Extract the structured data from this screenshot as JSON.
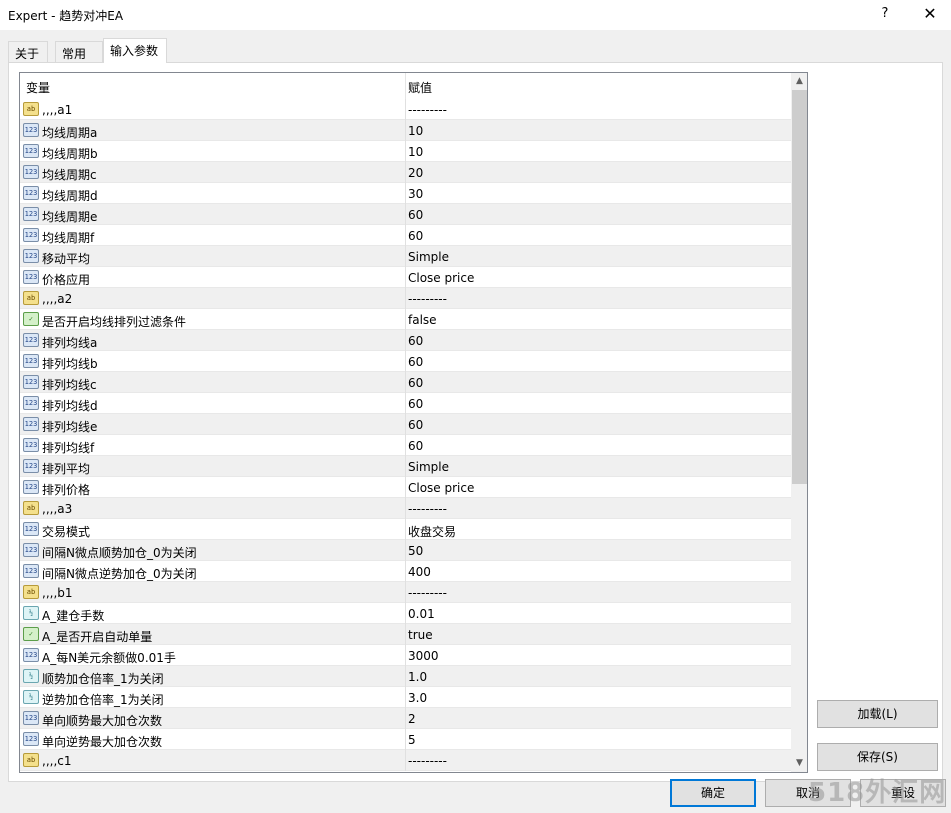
{
  "window": {
    "title": "Expert - 趋势对冲EA",
    "help_glyph": "?",
    "close_glyph": "✕"
  },
  "tabs": [
    {
      "label": "关于",
      "active": false
    },
    {
      "label": "常用",
      "active": false
    },
    {
      "label": "输入参数",
      "active": true
    }
  ],
  "grid": {
    "col_variable": "变量",
    "col_value": "赋值",
    "rows": [
      {
        "type": "str",
        "icon": "string-icon",
        "icon_text": "ab",
        "name": ",,,,a1",
        "value": "---------"
      },
      {
        "type": "int",
        "icon": "integer-icon",
        "icon_text": "123",
        "name": "均线周期a",
        "value": "10"
      },
      {
        "type": "int",
        "icon": "integer-icon",
        "icon_text": "123",
        "name": "均线周期b",
        "value": "10"
      },
      {
        "type": "int",
        "icon": "integer-icon",
        "icon_text": "123",
        "name": "均线周期c",
        "value": "20"
      },
      {
        "type": "int",
        "icon": "integer-icon",
        "icon_text": "123",
        "name": "均线周期d",
        "value": "30"
      },
      {
        "type": "int",
        "icon": "integer-icon",
        "icon_text": "123",
        "name": "均线周期e",
        "value": "60"
      },
      {
        "type": "int",
        "icon": "integer-icon",
        "icon_text": "123",
        "name": "均线周期f",
        "value": "60"
      },
      {
        "type": "int",
        "icon": "integer-icon",
        "icon_text": "123",
        "name": "移动平均",
        "value": "Simple"
      },
      {
        "type": "int",
        "icon": "integer-icon",
        "icon_text": "123",
        "name": "价格应用",
        "value": "Close price"
      },
      {
        "type": "str",
        "icon": "string-icon",
        "icon_text": "ab",
        "name": ",,,,a2",
        "value": "---------"
      },
      {
        "type": "bool",
        "icon": "boolean-icon",
        "icon_text": "✓",
        "name": "是否开启均线排列过滤条件",
        "value": "false"
      },
      {
        "type": "int",
        "icon": "integer-icon",
        "icon_text": "123",
        "name": "排列均线a",
        "value": "60"
      },
      {
        "type": "int",
        "icon": "integer-icon",
        "icon_text": "123",
        "name": "排列均线b",
        "value": "60"
      },
      {
        "type": "int",
        "icon": "integer-icon",
        "icon_text": "123",
        "name": "排列均线c",
        "value": "60"
      },
      {
        "type": "int",
        "icon": "integer-icon",
        "icon_text": "123",
        "name": "排列均线d",
        "value": "60"
      },
      {
        "type": "int",
        "icon": "integer-icon",
        "icon_text": "123",
        "name": "排列均线e",
        "value": "60"
      },
      {
        "type": "int",
        "icon": "integer-icon",
        "icon_text": "123",
        "name": "排列均线f",
        "value": "60"
      },
      {
        "type": "int",
        "icon": "integer-icon",
        "icon_text": "123",
        "name": "排列平均",
        "value": "Simple"
      },
      {
        "type": "int",
        "icon": "integer-icon",
        "icon_text": "123",
        "name": "排列价格",
        "value": "Close price"
      },
      {
        "type": "str",
        "icon": "string-icon",
        "icon_text": "ab",
        "name": ",,,,a3",
        "value": "---------"
      },
      {
        "type": "int",
        "icon": "integer-icon",
        "icon_text": "123",
        "name": "交易模式",
        "value": "收盘交易"
      },
      {
        "type": "int",
        "icon": "integer-icon",
        "icon_text": "123",
        "name": "间隔N微点顺势加仓_0为关闭",
        "value": "50"
      },
      {
        "type": "int",
        "icon": "integer-icon",
        "icon_text": "123",
        "name": "间隔N微点逆势加仓_0为关闭",
        "value": "400"
      },
      {
        "type": "str",
        "icon": "string-icon",
        "icon_text": "ab",
        "name": ",,,,b1",
        "value": "---------"
      },
      {
        "type": "dbl",
        "icon": "double-icon",
        "icon_text": "½",
        "name": "A_建仓手数",
        "value": "0.01"
      },
      {
        "type": "bool",
        "icon": "boolean-icon",
        "icon_text": "✓",
        "name": "A_是否开启自动单量",
        "value": "true"
      },
      {
        "type": "int",
        "icon": "integer-icon",
        "icon_text": "123",
        "name": "A_每N美元余额做0.01手",
        "value": "3000"
      },
      {
        "type": "dbl",
        "icon": "double-icon",
        "icon_text": "½",
        "name": "顺势加仓倍率_1为关闭",
        "value": "1.0"
      },
      {
        "type": "dbl",
        "icon": "double-icon",
        "icon_text": "½",
        "name": "逆势加仓倍率_1为关闭",
        "value": "3.0"
      },
      {
        "type": "int",
        "icon": "integer-icon",
        "icon_text": "123",
        "name": "单向顺势最大加仓次数",
        "value": "2"
      },
      {
        "type": "int",
        "icon": "integer-icon",
        "icon_text": "123",
        "name": "单向逆势最大加仓次数",
        "value": "5"
      },
      {
        "type": "str",
        "icon": "string-icon",
        "icon_text": "ab",
        "name": ",,,,c1",
        "value": "---------"
      }
    ]
  },
  "buttons": {
    "load": "加载(L)",
    "save": "保存(S)",
    "ok": "确定",
    "cancel": "取消",
    "reset": "重设"
  },
  "watermark": "518外汇网"
}
